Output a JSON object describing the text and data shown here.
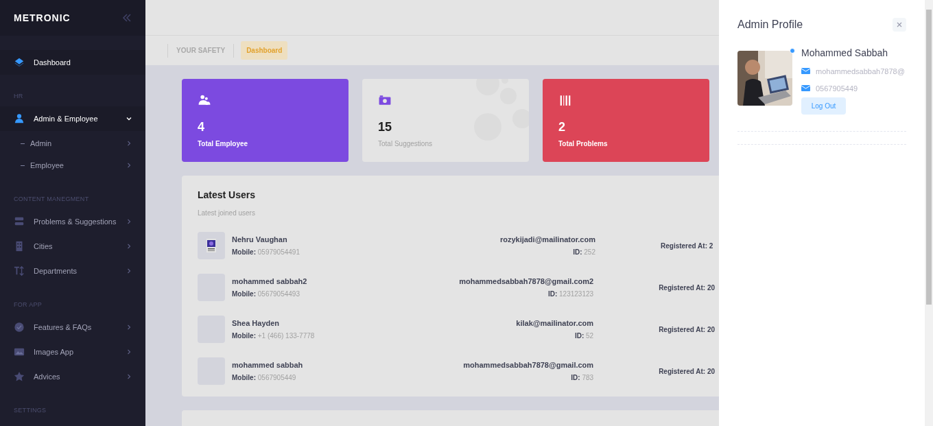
{
  "sidebar": {
    "logo": "METRONIC",
    "items": [
      {
        "kind": "link",
        "label": "Dashboard",
        "selected": true
      },
      {
        "kind": "heading",
        "label": "HR"
      },
      {
        "kind": "link",
        "label": "Admin & Employee",
        "selected": true,
        "expanded": true,
        "children": [
          {
            "label": "Admin"
          },
          {
            "label": "Employee"
          }
        ]
      },
      {
        "kind": "heading",
        "label": "CONTENT MANEGMENT"
      },
      {
        "kind": "link",
        "label": "Problems & Suggestions",
        "selected": false,
        "expanded": false
      },
      {
        "kind": "link",
        "label": "Cities",
        "selected": false,
        "expanded": false
      },
      {
        "kind": "link",
        "label": "Departments",
        "selected": false,
        "expanded": false
      },
      {
        "kind": "heading",
        "label": "FOR APP"
      },
      {
        "kind": "link",
        "label": "Features & FAQs",
        "selected": false,
        "expanded": false
      },
      {
        "kind": "link",
        "label": "Images App",
        "selected": false,
        "expanded": false
      },
      {
        "kind": "link",
        "label": "Advices",
        "selected": false,
        "expanded": false
      },
      {
        "kind": "heading",
        "label": "SETTINGS"
      }
    ]
  },
  "breadcrumb": [
    {
      "label": "YOUR SAFETY",
      "selected": false
    },
    {
      "label": "Dashboard",
      "selected": true
    }
  ],
  "stats": [
    {
      "value": "4",
      "label": "Total Employee",
      "color": "#7c4ae0"
    },
    {
      "value": "15",
      "label": "Total Suggestions",
      "color": "#e4e4e4"
    },
    {
      "value": "2",
      "label": "Total Problems",
      "color": "#dc4557"
    }
  ],
  "latest_users": {
    "title": "Latest Users",
    "subtitle": "Latest joined users",
    "rows": [
      {
        "has_avatar": true,
        "name": "Nehru Vaughan",
        "mobile_label": "Mobile:",
        "mobile": "05979054491",
        "email": "rozykijadi@mailinator.com",
        "id_label": "ID:",
        "id": "252",
        "registered": "Registered At: 2"
      },
      {
        "has_avatar": false,
        "name": "mohammed sabbah2",
        "mobile_label": "Mobile:",
        "mobile": "05679054493",
        "email": "mohammedsabbah7878@gmail.com2",
        "id_label": "ID:",
        "id": "123123123",
        "registered": "Registered At: 20"
      },
      {
        "has_avatar": false,
        "name": "Shea Hayden",
        "mobile_label": "Mobile:",
        "mobile": "+1 (466) 133-7778",
        "email": "kilak@mailinator.com",
        "id_label": "ID:",
        "id": "52",
        "registered": "Registered At: 20"
      },
      {
        "has_avatar": false,
        "name": "mohammed sabbah",
        "mobile_label": "Mobile:",
        "mobile": "0567905449",
        "email": "mohammedsabbah7878@gmail.com",
        "id_label": "ID:",
        "id": "783",
        "registered": "Registered At: 20"
      }
    ]
  },
  "profile_panel": {
    "title": "Admin Profile",
    "online": true,
    "name": "Mohammed Sabbah",
    "email": "mohammedsabbah7878@",
    "phone": "0567905449",
    "button": "Log Out"
  }
}
